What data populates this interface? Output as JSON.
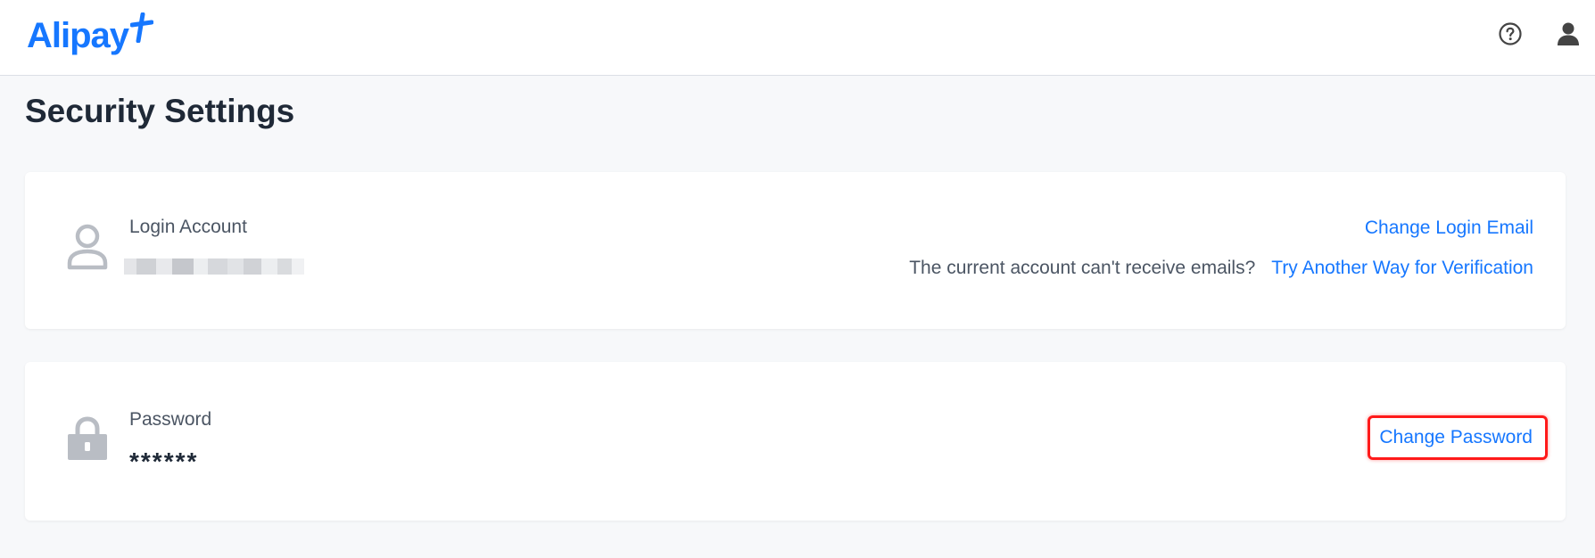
{
  "header": {
    "logo_text": "Alipay",
    "help_icon": "help-circle-icon",
    "user_icon": "user-icon"
  },
  "page": {
    "title": "Security Settings"
  },
  "login_account": {
    "label": "Login Account",
    "icon": "user-outline-icon",
    "change_email_link": "Change Login Email",
    "cant_receive_text": "The current account can't receive emails?",
    "alt_verify_link": "Try Another Way for Verification"
  },
  "password": {
    "label": "Password",
    "icon": "lock-icon",
    "value": "******",
    "change_link": "Change Password"
  },
  "colors": {
    "brand": "#1677ff",
    "highlight": "#ff1a1a"
  }
}
